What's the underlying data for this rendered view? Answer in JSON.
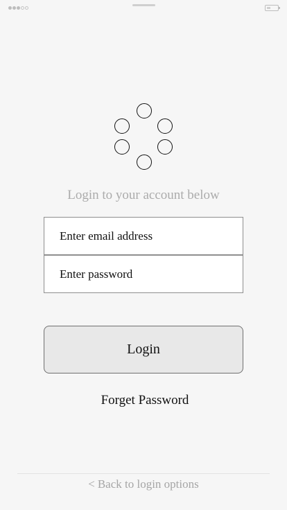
{
  "subtitle": "Login to your account below",
  "form": {
    "email_placeholder": "Enter email address",
    "password_placeholder": "Enter password"
  },
  "login_label": "Login",
  "forget_password_label": "Forget Password",
  "back_link": {
    "chevron": "<",
    "label": "Back to login options"
  },
  "icons": {
    "logo": "six-circle-ring-logo-icon",
    "signal": "signal-dots-icon",
    "battery": "battery-icon"
  },
  "colors": {
    "background": "#f6f6f6",
    "subtitle": "#ababab",
    "button_background": "#e8e8e8",
    "back_link": "#a5a5a5"
  }
}
